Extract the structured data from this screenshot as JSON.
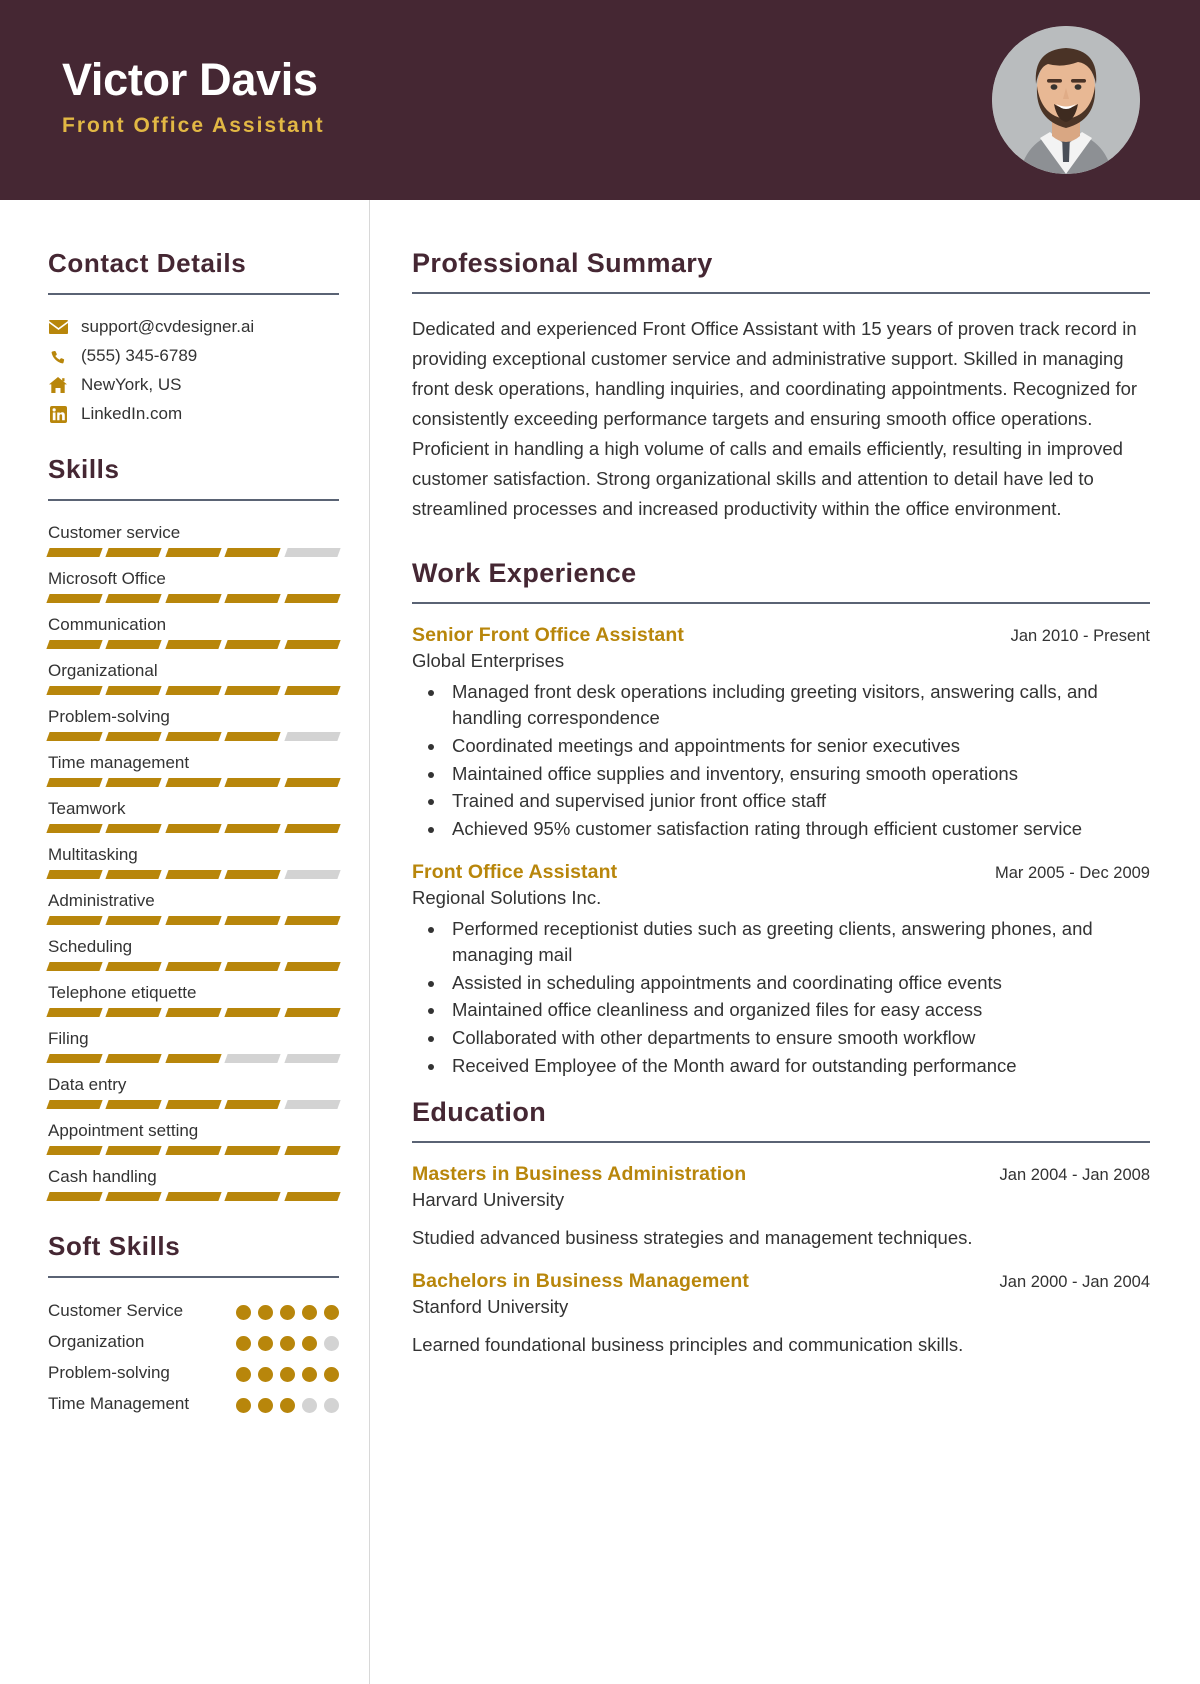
{
  "theme": {
    "header_bg": "#452733",
    "accent_gold": "#b8860b",
    "title_gold": "#e2b844",
    "rule_color": "#5a6374",
    "muted_gray": "#d3d3d3"
  },
  "header": {
    "name": "Victor Davis",
    "job_title": "Front Office Assistant",
    "avatar_alt": "profile-photo"
  },
  "sidebar": {
    "contact": {
      "heading": "Contact Details",
      "items": [
        {
          "icon": "envelope-icon",
          "value": "support@cvdesigner.ai"
        },
        {
          "icon": "phone-icon",
          "value": "(555) 345-6789"
        },
        {
          "icon": "home-icon",
          "value": "NewYork, US"
        },
        {
          "icon": "linkedin-icon",
          "value": "LinkedIn.com"
        }
      ]
    },
    "skills": {
      "heading": "Skills",
      "max": 5,
      "items": [
        {
          "name": "Customer service",
          "level": 4
        },
        {
          "name": "Microsoft Office",
          "level": 5
        },
        {
          "name": "Communication",
          "level": 5
        },
        {
          "name": "Organizational",
          "level": 5
        },
        {
          "name": "Problem-solving",
          "level": 4
        },
        {
          "name": "Time management",
          "level": 5
        },
        {
          "name": "Teamwork",
          "level": 5
        },
        {
          "name": "Multitasking",
          "level": 4
        },
        {
          "name": "Administrative",
          "level": 5
        },
        {
          "name": "Scheduling",
          "level": 5
        },
        {
          "name": "Telephone etiquette",
          "level": 5
        },
        {
          "name": "Filing",
          "level": 3
        },
        {
          "name": "Data entry",
          "level": 4
        },
        {
          "name": "Appointment setting",
          "level": 5
        },
        {
          "name": "Cash handling",
          "level": 5
        }
      ]
    },
    "soft_skills": {
      "heading": "Soft Skills",
      "max": 5,
      "items": [
        {
          "name": "Customer Service",
          "level": 5
        },
        {
          "name": "Organization",
          "level": 4
        },
        {
          "name": "Problem-solving",
          "level": 5
        },
        {
          "name": "Time Management",
          "level": 3
        }
      ]
    }
  },
  "main": {
    "summary": {
      "heading": "Professional Summary",
      "text": "Dedicated and experienced Front Office Assistant with 15 years of proven track record in providing exceptional customer service and administrative support. Skilled in managing front desk operations, handling inquiries, and coordinating appointments. Recognized for consistently exceeding performance targets and ensuring smooth office operations. Proficient in handling a high volume of calls and emails efficiently, resulting in improved customer satisfaction. Strong organizational skills and attention to detail have led to streamlined processes and increased productivity within the office environment."
    },
    "work": {
      "heading": "Work Experience",
      "entries": [
        {
          "role": "Senior Front Office Assistant",
          "date": "Jan 2010 - Present",
          "org": "Global Enterprises",
          "bullets": [
            "Managed front desk operations including greeting visitors, answering calls, and handling correspondence",
            "Coordinated meetings and appointments for senior executives",
            "Maintained office supplies and inventory, ensuring smooth operations",
            "Trained and supervised junior front office staff",
            "Achieved 95% customer satisfaction rating through efficient customer service"
          ]
        },
        {
          "role": "Front Office Assistant",
          "date": "Mar 2005 - Dec 2009",
          "org": "Regional Solutions Inc.",
          "bullets": [
            "Performed receptionist duties such as greeting clients, answering phones, and managing mail",
            "Assisted in scheduling appointments and coordinating office events",
            "Maintained office cleanliness and organized files for easy access",
            "Collaborated with other departments to ensure smooth workflow",
            "Received Employee of the Month award for outstanding performance"
          ]
        }
      ]
    },
    "education": {
      "heading": "Education",
      "entries": [
        {
          "degree": "Masters in Business Administration",
          "date": "Jan 2004 - Jan 2008",
          "school": "Harvard University",
          "description": "Studied advanced business strategies and management techniques."
        },
        {
          "degree": "Bachelors in Business Management",
          "date": "Jan 2000 - Jan 2004",
          "school": "Stanford University",
          "description": "Learned foundational business principles and communication skills."
        }
      ]
    }
  }
}
